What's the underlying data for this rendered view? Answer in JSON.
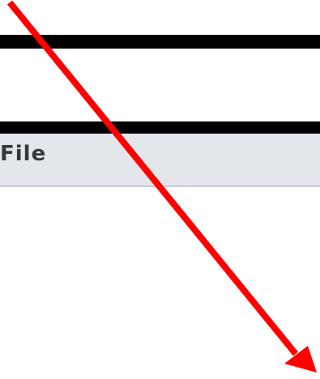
{
  "menu": {
    "file_label": "File"
  },
  "annotation": {
    "arrow_icon": "red-arrow-icon",
    "arrow_color": "#ff0000"
  },
  "colors": {
    "menu_background": "#e3e7ec",
    "bars": "#000000"
  }
}
